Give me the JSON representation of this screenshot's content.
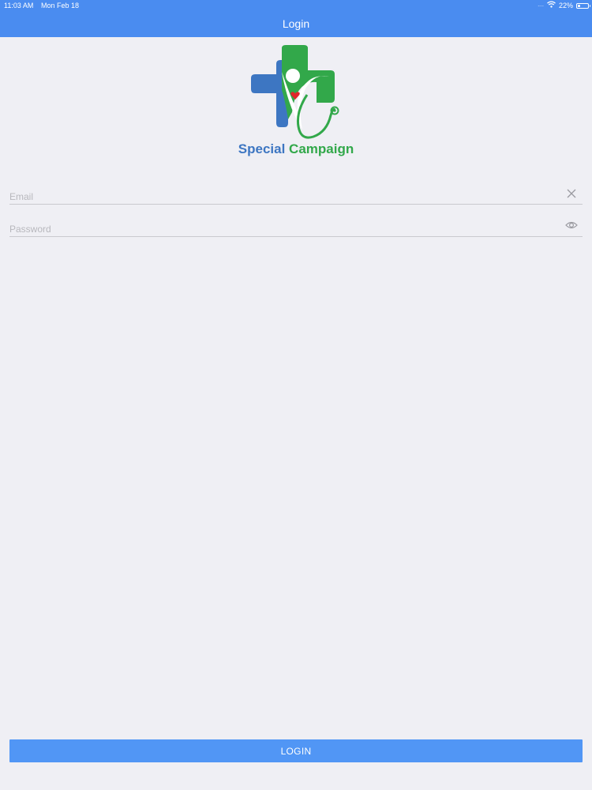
{
  "status_bar": {
    "time": "11:03 AM",
    "date": "Mon Feb 18",
    "signal": "....",
    "battery_text": "22%",
    "battery_level": 0.22,
    "wifi_icon": "wifi-icon",
    "battery_icon": "battery-icon"
  },
  "nav": {
    "title": "Login"
  },
  "logo": {
    "text_part1": "Special",
    "text_part2": "Campaign",
    "colors": {
      "blue": "#3d76c2",
      "green": "#32a84a",
      "heart": "#e0262b"
    }
  },
  "form": {
    "email": {
      "placeholder": "Email",
      "value": "",
      "action_icon": "clear-icon"
    },
    "password": {
      "placeholder": "Password",
      "value": "",
      "action_icon": "eye-icon"
    },
    "login_label": "LOGIN"
  },
  "colors": {
    "header": "#4a8cf0",
    "button": "#5196f5",
    "background": "#efeff4"
  }
}
